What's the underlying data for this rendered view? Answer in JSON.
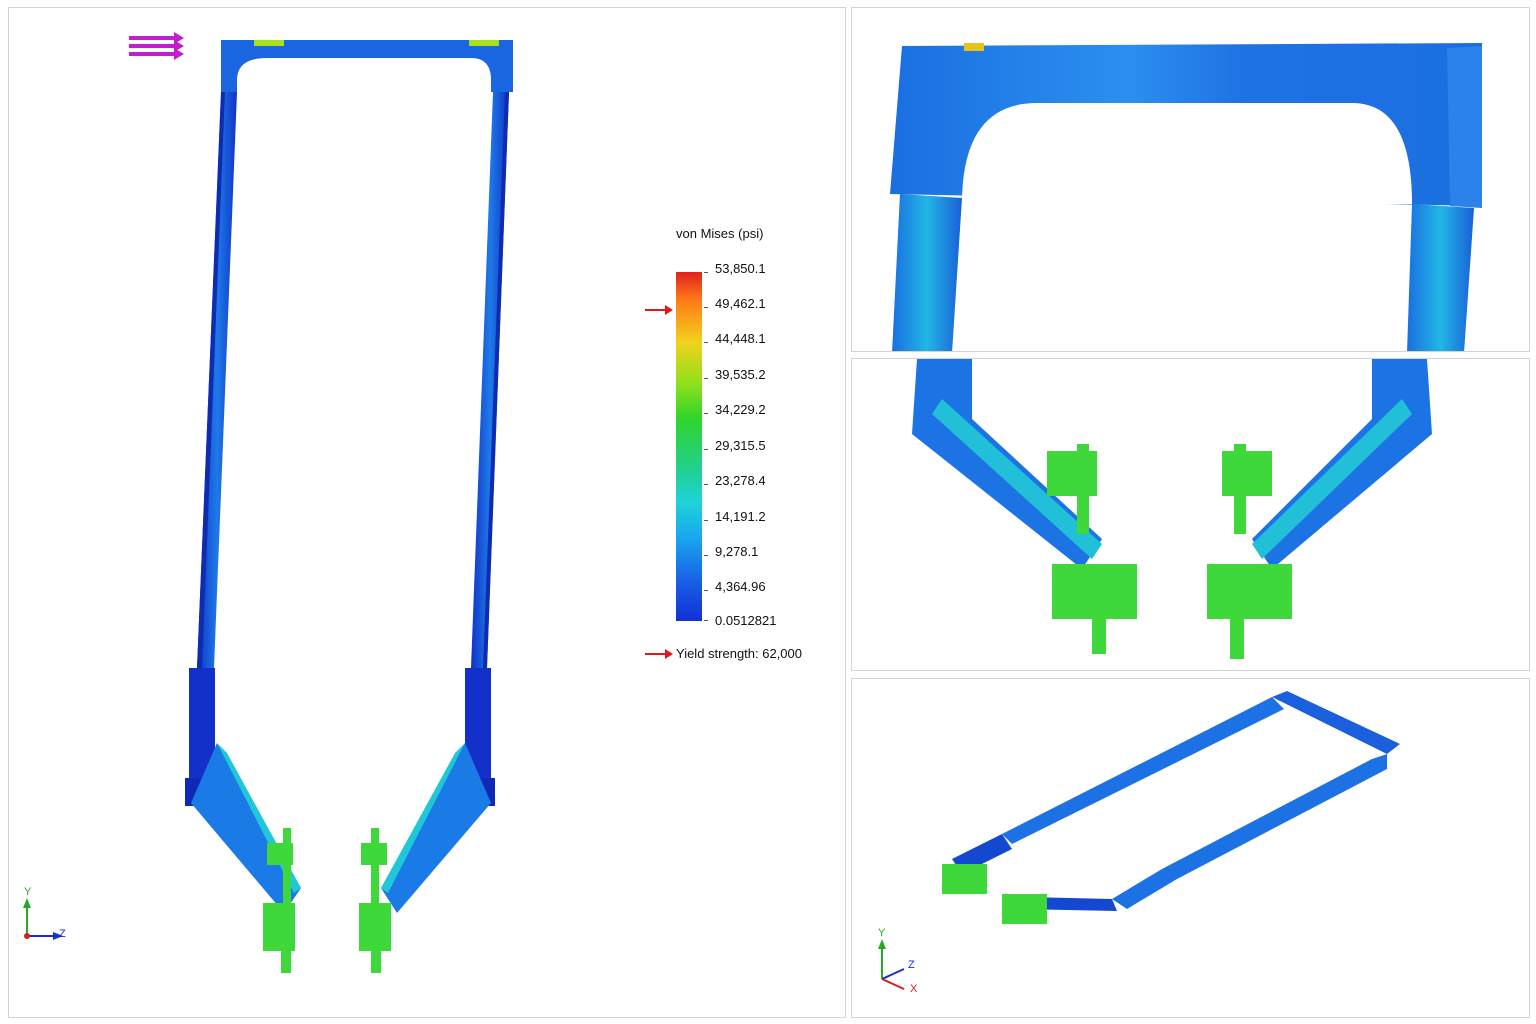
{
  "legend": {
    "title": "von Mises (psi)",
    "values": [
      "53,850.1",
      "49,462.1",
      "44,448.1",
      "39,535.2",
      "34,229.2",
      "29,315.5",
      "23,278.4",
      "14,191.2",
      "9,278.1",
      "4,364.96",
      "0.0512821"
    ],
    "yield_label": "Yield strength: 62,000"
  },
  "axes": {
    "main": {
      "y": "Y",
      "z": "Z"
    },
    "iso": {
      "y": "Y",
      "z": "Z",
      "x": "X"
    }
  },
  "colors": {
    "low": "#1330d6",
    "mid": "#2fd52a",
    "high": "#e0201e",
    "load_arrow": "#c21ed0",
    "yield_arrow": "#e01818"
  },
  "icons": {
    "load": "load-arrows-icon",
    "triad": "axis-triad-icon",
    "yield_marker": "red-arrow-icon"
  }
}
